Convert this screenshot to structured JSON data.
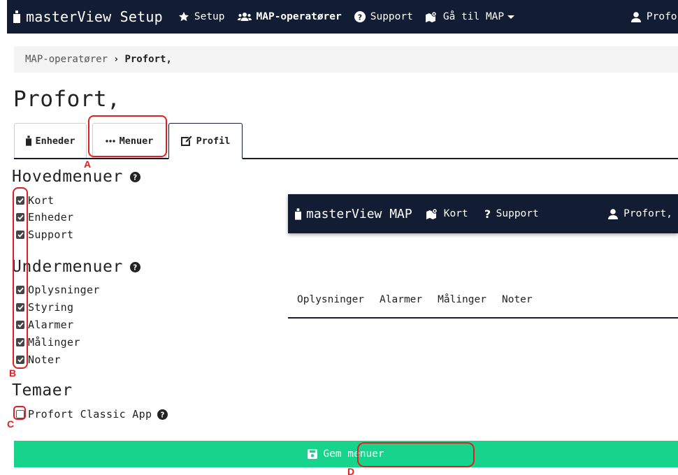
{
  "navbar": {
    "brand": "masterView Setup",
    "items": [
      {
        "label": "Setup",
        "icon": "star-icon"
      },
      {
        "label": "MAP-operatører",
        "icon": "users-icon",
        "active": true
      },
      {
        "label": "Support",
        "icon": "question-circle-icon"
      },
      {
        "label": "Gå til MAP",
        "icon": "map-icon"
      }
    ],
    "user": "Profort"
  },
  "breadcrumb": {
    "link": "MAP-operatører",
    "current": "Profort,"
  },
  "page_title": "Profort,",
  "tabs": [
    {
      "label": "Enheder",
      "icon": "device-icon"
    },
    {
      "label": "Menuer",
      "icon": "ellipsis-icon"
    },
    {
      "label": "Profil",
      "icon": "edit-icon"
    }
  ],
  "hovedmenuer": {
    "title": "Hovedmenuer",
    "items": [
      "Kort",
      "Enheder",
      "Support"
    ]
  },
  "undermenuer": {
    "title": "Undermenuer",
    "items": [
      "Oplysninger",
      "Styring",
      "Alarmer",
      "Målinger",
      "Noter"
    ]
  },
  "temaer": {
    "title": "Temaer",
    "items": [
      "Profort Classic App"
    ]
  },
  "preview": {
    "brand": "masterView MAP",
    "nav_items": [
      {
        "label": "Kort",
        "icon": "map-icon"
      },
      {
        "label": "Support",
        "icon": "question-icon"
      }
    ],
    "user": "Profort,",
    "tabs": [
      "Oplysninger",
      "Alarmer",
      "Målinger",
      "Noter"
    ]
  },
  "save_button": "Gem menuer",
  "annotations": [
    "A",
    "B",
    "C",
    "D"
  ],
  "colors": {
    "navbar": "#121d33",
    "save": "#16d48c",
    "annotation": "#e02020",
    "breadcrumb_bg": "#f4f4f4"
  }
}
